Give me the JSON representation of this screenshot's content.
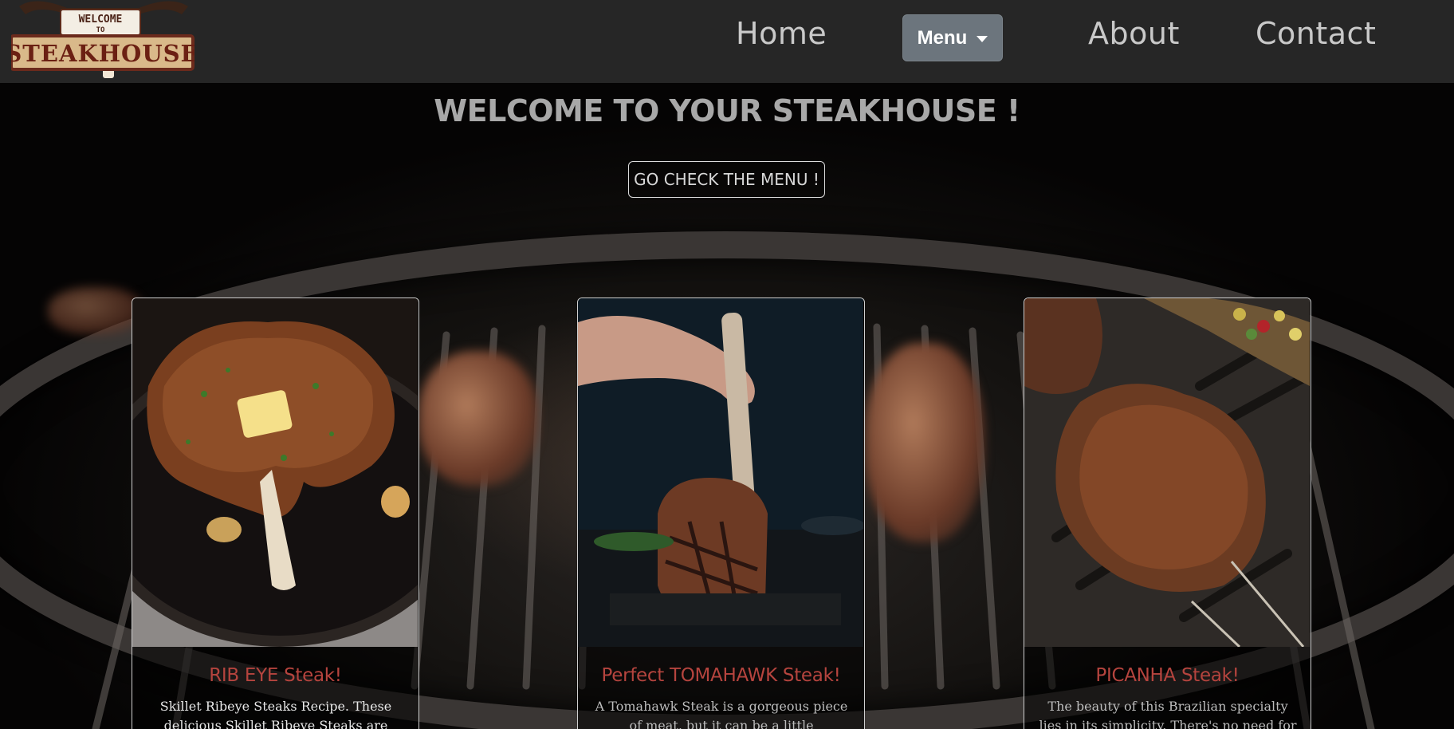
{
  "logo": {
    "line1": "WELCOME",
    "line2": "TO",
    "line3": "STEAKHOUSE"
  },
  "nav": {
    "home": "Home",
    "menu": "Menu",
    "about": "About",
    "contact": "Contact"
  },
  "hero": {
    "title": "WELCOME TO YOUR STEAKHOUSE !",
    "cta": "GO CHECK THE MENU !"
  },
  "cards": [
    {
      "title": "RIB EYE Steak!",
      "text": "Skillet Ribeye Steaks Recipe. These delicious Skillet Ribeye Steaks are butter-basted and will"
    },
    {
      "title": "Perfect TOMAHAWK Steak!",
      "text": "A Tomahawk Steak is a gorgeous piece of meat, but it can be a little intimidating to cook."
    },
    {
      "title": "PICANHA Steak!",
      "text": "The beauty of this Brazilian specialty lies in its simplicity. There's no need for complicated"
    }
  ],
  "colors": {
    "navbar": "#262626",
    "menu_button": "#6c757d",
    "card_title": "#b5443e"
  }
}
